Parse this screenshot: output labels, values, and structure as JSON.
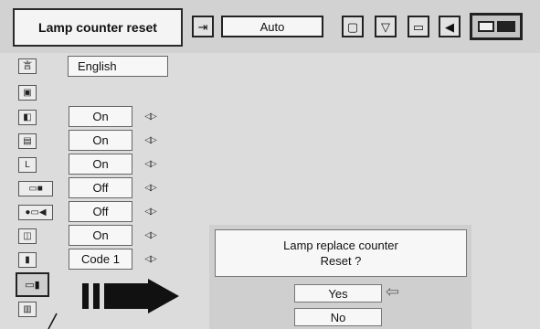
{
  "header": {
    "title": "Lamp counter reset",
    "input_icon": "input-switch-icon",
    "input_value": "Auto",
    "toolbar_icons": [
      "square-icon",
      "funnel-icon",
      "monitor-icon",
      "speaker-icon",
      "screen-icon"
    ]
  },
  "settings": {
    "language": "English",
    "rows": [
      {
        "icon": "keystone-icon",
        "value": "On"
      },
      {
        "icon": "frame-icon",
        "value": "On"
      },
      {
        "icon": "l-icon",
        "value": "On"
      },
      {
        "icon": "projector-icon",
        "value": "Off"
      },
      {
        "icon": "power-management-icon",
        "value": "Off"
      },
      {
        "icon": "sleep-icon",
        "value": "On"
      },
      {
        "icon": "remote-icon",
        "value": "Code 1"
      }
    ]
  },
  "dialog": {
    "line1": "Lamp replace counter",
    "line2": "Reset ?",
    "yes": "Yes",
    "no": "No"
  },
  "colors": {
    "background": "#dcdcdc",
    "bar": "#d2d2d2",
    "field": "#f7f7f7",
    "arrow": "#111111"
  }
}
